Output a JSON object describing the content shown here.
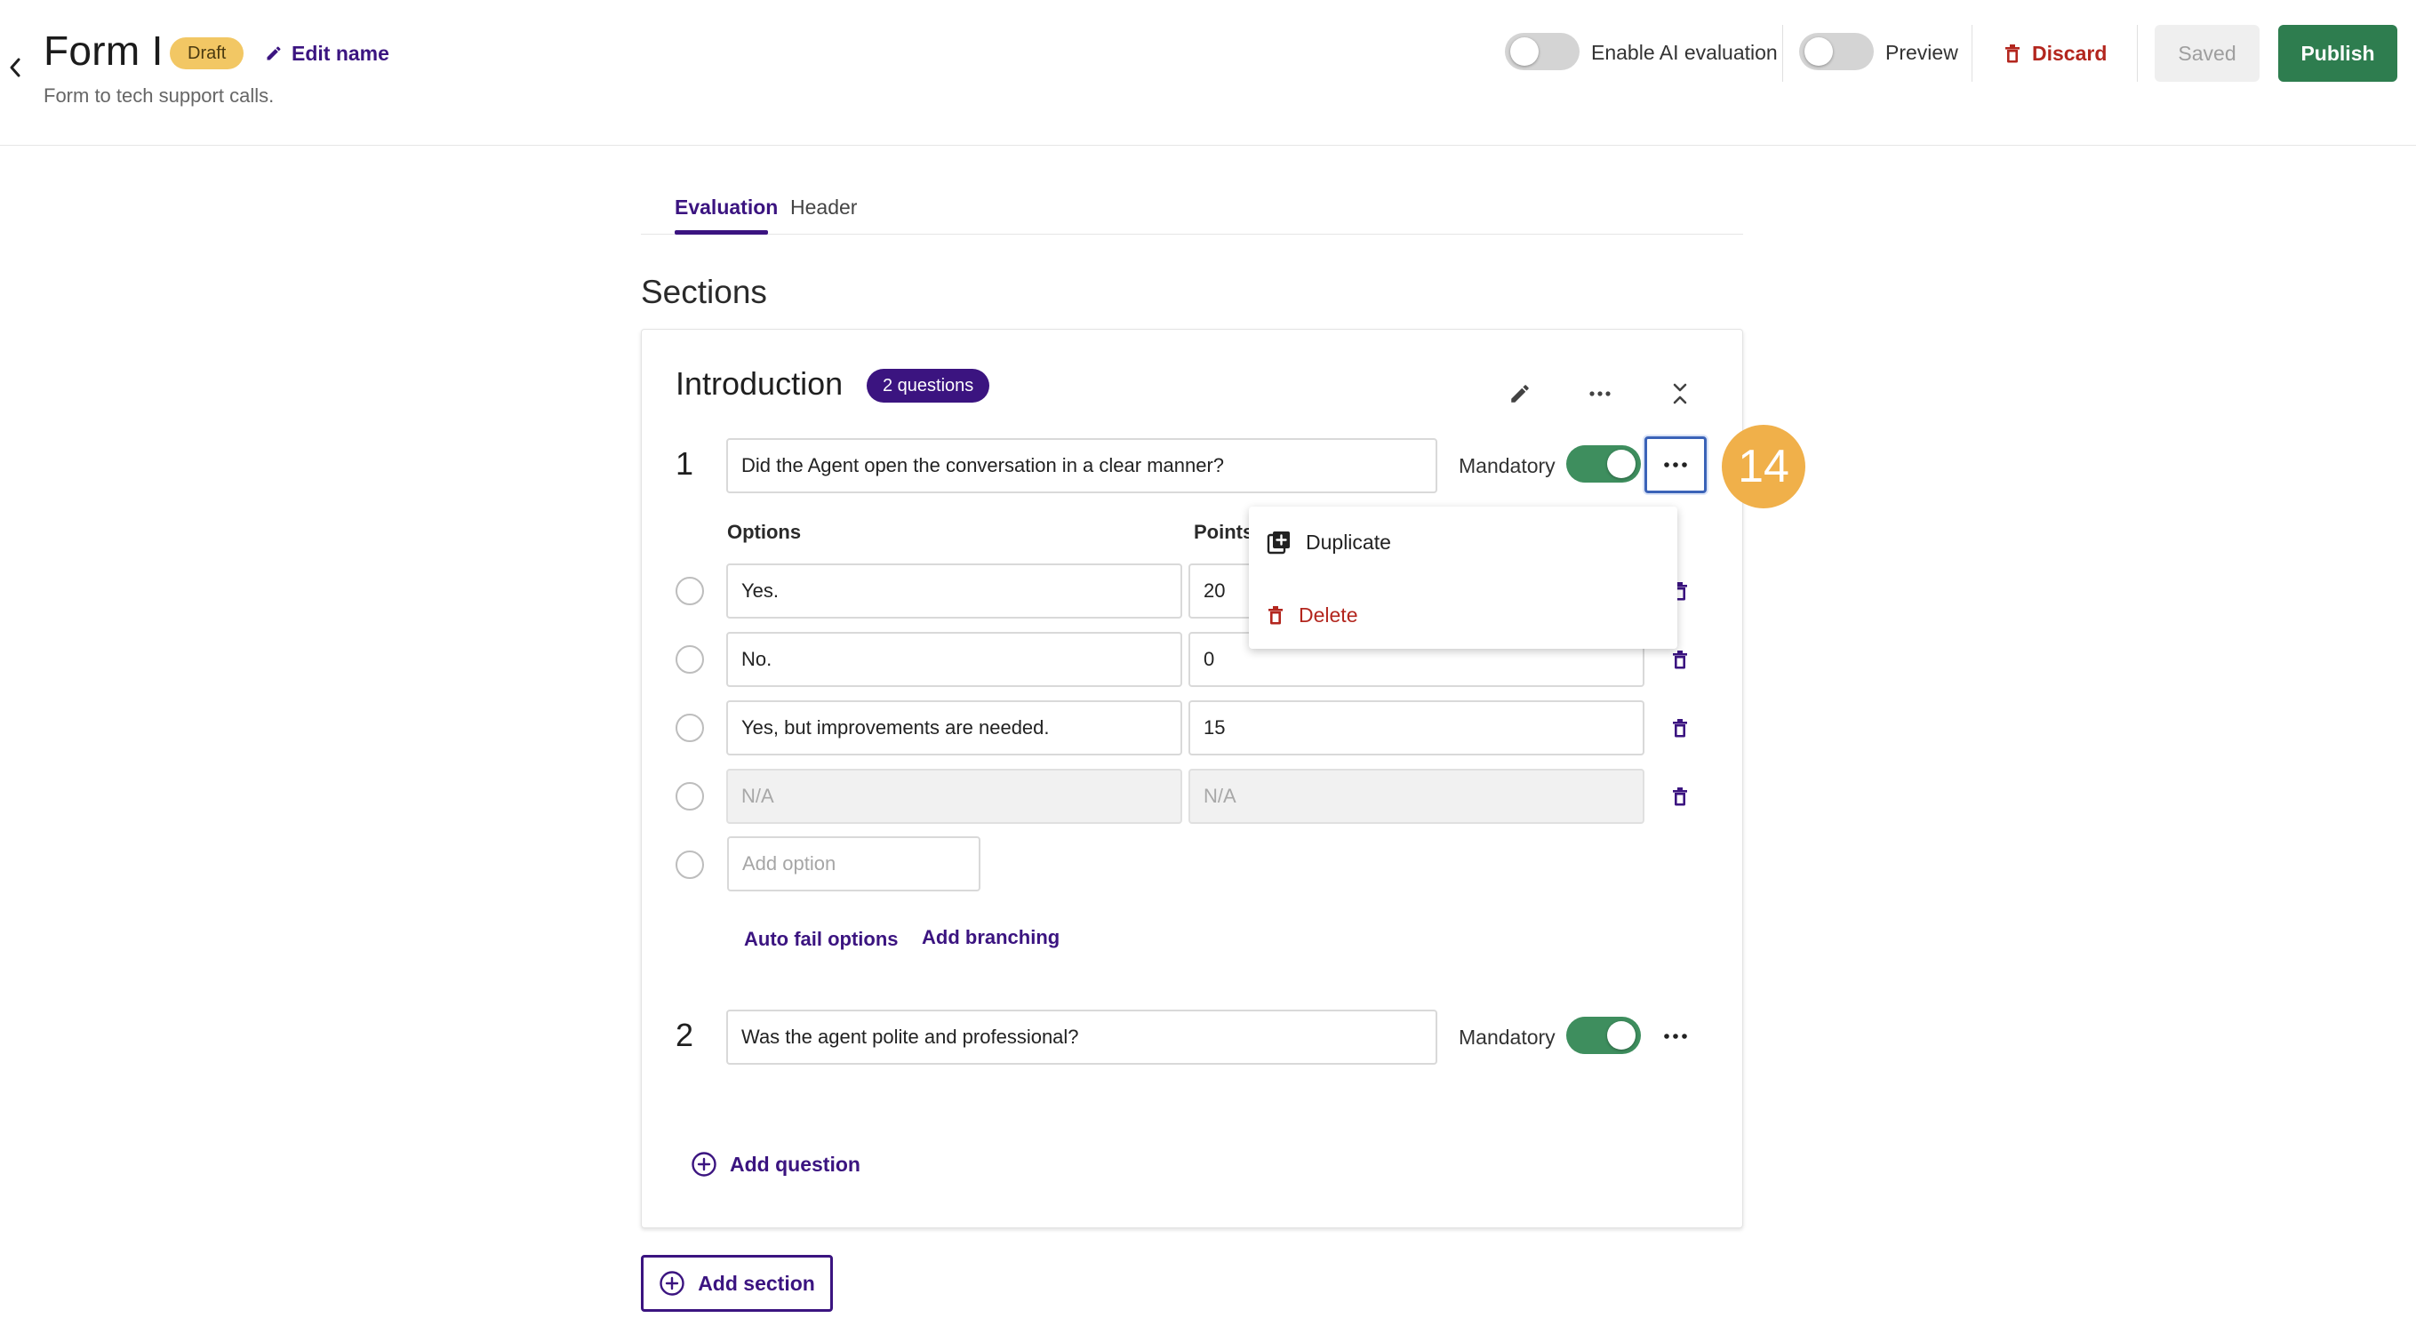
{
  "header": {
    "title": "Form I",
    "status_badge": "Draft",
    "edit_name_label": "Edit name",
    "subtitle": "Form to tech support calls.",
    "ai_evaluation_label": "Enable AI evaluation",
    "ai_evaluation_enabled": false,
    "preview_label": "Preview",
    "preview_enabled": false,
    "discard_label": "Discard",
    "saved_label": "Saved",
    "publish_label": "Publish"
  },
  "tabs": [
    {
      "label": "Evaluation",
      "active": true
    },
    {
      "label": "Header",
      "active": false
    }
  ],
  "sections_heading": "Sections",
  "section": {
    "title": "Introduction",
    "question_count_badge": "2 questions",
    "questions": [
      {
        "number": "1",
        "text": "Did the Agent open the conversation in a clear manner?",
        "mandatory_label": "Mandatory",
        "mandatory": true,
        "options_header": "Options",
        "points_header": "Points",
        "options": [
          {
            "label": "Yes.",
            "points": "20"
          },
          {
            "label": "No.",
            "points": "0"
          },
          {
            "label": "Yes, but improvements are needed.",
            "points": "15"
          },
          {
            "label": "N/A",
            "points": "N/A",
            "disabled": true
          }
        ],
        "add_option_placeholder": "Add option",
        "auto_fail_label": "Auto fail options",
        "add_branching_label": "Add branching"
      },
      {
        "number": "2",
        "text": "Was the agent polite and professional?",
        "mandatory_label": "Mandatory",
        "mandatory": true
      }
    ],
    "add_question_label": "Add question"
  },
  "menu": {
    "duplicate_label": "Duplicate",
    "delete_label": "Delete"
  },
  "step_badge": "14",
  "add_section_label": "Add section",
  "colors": {
    "accent": "#3b1480",
    "success": "#2e7d4f",
    "danger": "#b3261e",
    "badge_yellow": "#f2c764",
    "step_orange": "#f0b04a"
  }
}
